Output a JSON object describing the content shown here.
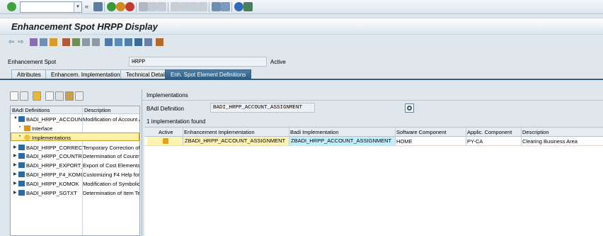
{
  "toolbar": {
    "command_value": "",
    "icons": [
      "check-icon",
      "save-icon",
      "back-icon",
      "exit-icon",
      "cancel-icon",
      "print-icon",
      "find-icon",
      "find-next-icon",
      "first-page-icon",
      "prev-page-icon",
      "next-page-icon",
      "last-page-icon",
      "new-session-icon",
      "shortcut-icon",
      "help-icon",
      "customize-icon"
    ]
  },
  "title": "Enhancement Spot HRPP Display",
  "field": {
    "label": "Enhancement Spot",
    "value": "HRPP",
    "status": "Active"
  },
  "tabs": [
    {
      "label": "Attributes",
      "active": false
    },
    {
      "label": "Enhancem. Implementations",
      "active": false
    },
    {
      "label": "Technical Details",
      "active": false
    },
    {
      "label": "Enh. Spot Element Definitions",
      "active": true
    }
  ],
  "tree": {
    "columns": [
      "BAdI Definitions",
      "Description"
    ],
    "rows": [
      {
        "label": "BADI_HRPP_ACCOUNT_ASSIGNMENT",
        "desc": "Modification of Account As",
        "level": 0,
        "expanded": true
      },
      {
        "label": "Interface",
        "desc": "",
        "level": 1
      },
      {
        "label": "Implementations",
        "desc": "",
        "level": 1,
        "selected": true
      },
      {
        "label": "BADI_HRPP_CORRECT_FI",
        "desc": "Temporary Correction of",
        "level": 0
      },
      {
        "label": "BADI_HRPP_COUNTRY_EXT",
        "desc": "Determination of Country",
        "level": 0
      },
      {
        "label": "BADI_HRPP_EXPORT_COST",
        "desc": "Export of Cost Elements",
        "level": 0
      },
      {
        "label": "BADI_HRPP_F4_KOMOK",
        "desc": "Customizing F4 Help for S",
        "level": 0
      },
      {
        "label": "BADI_HRPP_KOMOK",
        "desc": "Modification of Symbolic A",
        "level": 0
      },
      {
        "label": "BADI_HRPP_SGTXT",
        "desc": "Determination of Item Te",
        "level": 0
      }
    ]
  },
  "implementations": {
    "header": "Implementations",
    "badi_label": "BAdI Definition",
    "badi_value": "BADI_HRPP_ACCOUNT_ASSIGNMENT",
    "found_text": "1 implementation found",
    "columns": [
      "Active",
      "Enhancement Implementation",
      "Badi Implementation",
      "Software Component",
      "Applic. Component",
      "Description"
    ],
    "rows": [
      {
        "enh": "ZBADI_HRPP_ACCOUNT_ASSIGNMENT",
        "badi": "ZBADI_HRPP_ACCOUNT_ASSIGNMENT",
        "sw": "HOME",
        "app": "PY-CA",
        "desc": "Clearing Business Area"
      }
    ]
  },
  "colors": {
    "accent": "#2a5a82",
    "row_highlight_yellow": "#fff3b0",
    "row_highlight_cyan": "#bfeffc"
  }
}
